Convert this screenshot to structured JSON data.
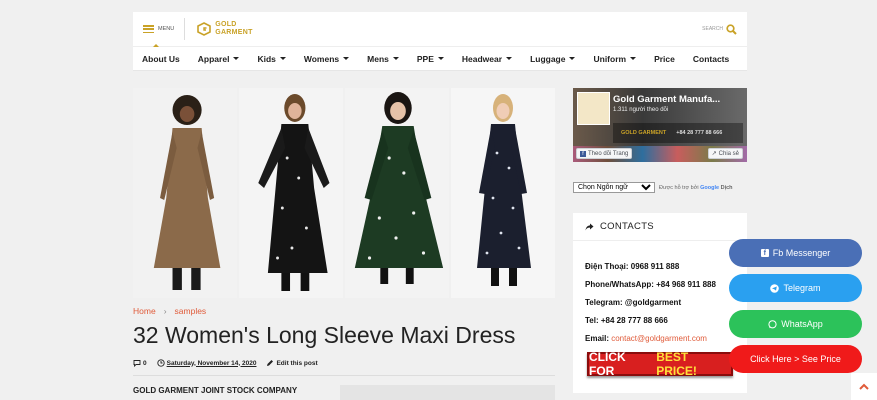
{
  "header": {
    "menu_label": "MENU",
    "logo_line1": "GOLD",
    "logo_line2": "GARMENT",
    "search_label": "SEARCH"
  },
  "nav": {
    "items": [
      {
        "label": "About Us",
        "dropdown": false
      },
      {
        "label": "Apparel",
        "dropdown": true
      },
      {
        "label": "Kids",
        "dropdown": true
      },
      {
        "label": "Womens",
        "dropdown": true
      },
      {
        "label": "Mens",
        "dropdown": true
      },
      {
        "label": "PPE",
        "dropdown": true
      },
      {
        "label": "Headwear",
        "dropdown": true
      },
      {
        "label": "Luggage",
        "dropdown": true
      },
      {
        "label": "Uniform",
        "dropdown": true
      },
      {
        "label": "Price",
        "dropdown": false
      },
      {
        "label": "Contacts",
        "dropdown": false
      }
    ]
  },
  "breadcrumb": {
    "home": "Home",
    "separator": "›",
    "current": "samples"
  },
  "post": {
    "title": "32 Women's Long Sleeve Maxi Dress",
    "comments": "0",
    "date": "Saturday, November 14, 2020",
    "edit": "Edit this post",
    "company": "GOLD GARMENT JOINT STOCK COMPANY"
  },
  "facebook": {
    "page_name": "Gold Garment Manufa...",
    "followers": "1.311 người theo dõi",
    "brand": "GOLD GARMENT",
    "phone": "+84 28 777 88 666",
    "follow_label": "Theo dõi Trang",
    "share_label": "Chia sẻ"
  },
  "translate": {
    "select_value": "Chọn Ngôn ngữ",
    "powered": "Được hỗ trợ bởi",
    "google": "Google",
    "translate_word": "Dịch"
  },
  "contacts": {
    "heading": "CONTACTS",
    "phone": "Điện Thoại: 0968 911 888",
    "whatsapp": "Phone/WhatsApp: +84 968 911 888",
    "telegram": "Telegram: @goldgarment",
    "tel": "Tel: +84 28 777 88 666",
    "email_label": "Email: ",
    "email": "contact@goldgarment.com",
    "cta_part1": "CLICK FOR",
    "cta_part2": "BEST PRICE!"
  },
  "floating": {
    "messenger": "Fb Messenger",
    "telegram": "Telegram",
    "whatsapp": "WhatsApp",
    "price": "Click Here > See Price"
  },
  "colors": {
    "gold": "#c9a227",
    "link": "#e05b3a",
    "messenger": "#4a6fb6",
    "telegram": "#2aa0f0",
    "whatsapp": "#2cc25a",
    "price": "#f01a1a"
  }
}
